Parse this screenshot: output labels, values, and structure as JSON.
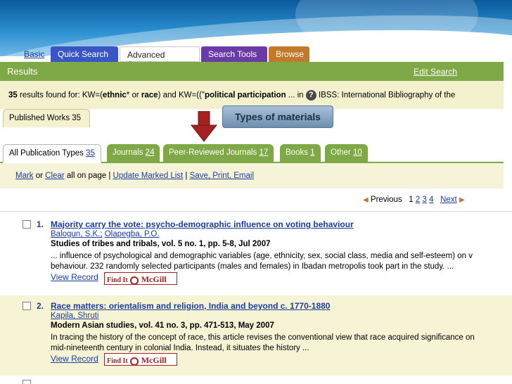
{
  "top_tabs": [
    "Basic",
    "Quick Search",
    "Advanced Search",
    "Search Tools",
    "Browse"
  ],
  "results_bar": {
    "title": "Results",
    "edit_search": "Edit Search"
  },
  "found_line": {
    "count": "35",
    "prefix": "results found for: KW=(",
    "term1": "ethnic",
    "mid1": "* or ",
    "term2": "race",
    "mid2": ") and KW=((\"",
    "term3": "political participation",
    "suffix": " ... in",
    "help_icon": "?",
    "database": "IBSS: International Bibliography of the"
  },
  "published_tab": "Published Works 35",
  "callout": "Types of materials",
  "type_tabs": [
    {
      "label": "All Publication Types ",
      "count": "35",
      "active": true
    },
    {
      "label": "Journals ",
      "count": "24",
      "active": false
    },
    {
      "label": "Peer-Reviewed Journals ",
      "count": "17",
      "active": false
    },
    {
      "label": "Books ",
      "count": "1",
      "active": false
    },
    {
      "label": "Other ",
      "count": "10",
      "active": false
    }
  ],
  "action_bar": {
    "mark": "Mark",
    "or": " or ",
    "clear": "Clear",
    "rest": " all on page  |  ",
    "update": "Update Marked List",
    "sep": "  |  ",
    "save": "Save, Print, Email"
  },
  "pager": {
    "previous": "Previous",
    "current": "1",
    "pages": [
      "2",
      "3",
      "4"
    ],
    "next": "Next"
  },
  "records": [
    {
      "number": "1.",
      "title": "Majority carry the vote: psycho-demographic influence on voting behaviour",
      "authors": [
        "Balogun, S.K.;",
        "Olapegba, P.O."
      ],
      "source": "Studies of tribes and tribals, vol. 5 no. 1, pp. 5-8, Jul 2007",
      "abstract_line1": "... influence of psychological and demographic variables (age, ethnicity, sex, social class, media and self-esteem) on v",
      "abstract_line2": "behaviour. 232 randomly selected participants (males and females) in Ibadan metropolis took part in the study. ...",
      "view_record": "View Record",
      "findit": "Find It",
      "mcgill": "McGill"
    },
    {
      "number": "2.",
      "title": "Race matters: orientalism and religion, India and beyond c. 1770-1880",
      "authors": [
        "Kapila, Shruti"
      ],
      "source": "Modern Asian studies, vol. 41 no. 3, pp. 471-513, May 2007",
      "abstract_line1": "In tracing the history of the concept of race, this article revises the conventional view that race acquired significance on",
      "abstract_line2": "mid-nineteenth century in colonial India. Instead, it situates the history ...",
      "view_record": "View Record",
      "findit": "Find It",
      "mcgill": "McGill"
    }
  ],
  "colors": {
    "green": "#7fa847",
    "link": "#1a3c9e",
    "cream": "#f4f1cf",
    "arrow": "#a62222"
  }
}
